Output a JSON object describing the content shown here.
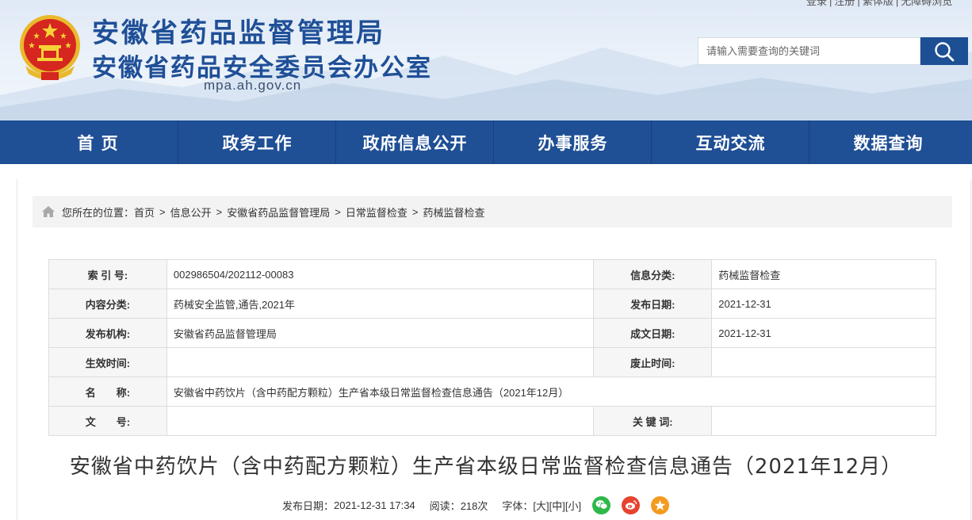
{
  "header": {
    "title_line1": "安徽省药品监督管理局",
    "title_line2": "安徽省药品安全委员会办公室",
    "domain": "mpa.ah.gov.cn",
    "top_links": [
      "登录",
      "注册",
      "繁体版",
      "无障碍浏览"
    ]
  },
  "search": {
    "placeholder": "请输入需要查询的关键词",
    "icon": "search-icon"
  },
  "nav": {
    "items": [
      "首 页",
      "政务工作",
      "政府信息公开",
      "办事服务",
      "互动交流",
      "数据查询"
    ]
  },
  "breadcrumb": {
    "prefix": "您所在的位置：",
    "items": [
      "首页",
      "信息公开",
      "安徽省药品监督管理局",
      "日常监督检查",
      "药械监督检查"
    ],
    "separator": ">"
  },
  "info": {
    "index_label": "索 引 号:",
    "index_value": "002986504/202112-00083",
    "category_label": "信息分类:",
    "category_value": "药械监督检查",
    "content_label": "内容分类:",
    "content_value": "药械安全监管,通告,2021年",
    "publish_date_label": "发布日期:",
    "publish_date_value": "2021-12-31",
    "org_label": "发布机构:",
    "org_value": "安徽省药品监督管理局",
    "doc_date_label": "成文日期:",
    "doc_date_value": "2021-12-31",
    "effective_label": "生效时间:",
    "effective_value": "",
    "expire_label": "废止时间:",
    "expire_value": "",
    "name_label": "名　　称:",
    "name_value": "安徽省中药饮片（含中药配方颗粒）生产省本级日常监督检查信息通告（2021年12月）",
    "docno_label": "文　　号:",
    "docno_value": "",
    "keywords_label": "关 键 词:",
    "keywords_value": ""
  },
  "article": {
    "title": "安徽省中药饮片（含中药配方颗粒）生产省本级日常监督检查信息通告（2021年12月）",
    "publish_label": "发布日期：",
    "publish_time": "2021-12-31 17:34",
    "reads_label": "阅读：",
    "reads_value": "218次",
    "font_label": "字体：",
    "font_large": "[大]",
    "font_medium": "[中]",
    "font_small": "[小]"
  },
  "colors": {
    "brand_blue": "#1f4f95",
    "wechat_green": "#2fb84a",
    "weibo_red": "#e6432f",
    "favorite_orange": "#f49b1e"
  }
}
